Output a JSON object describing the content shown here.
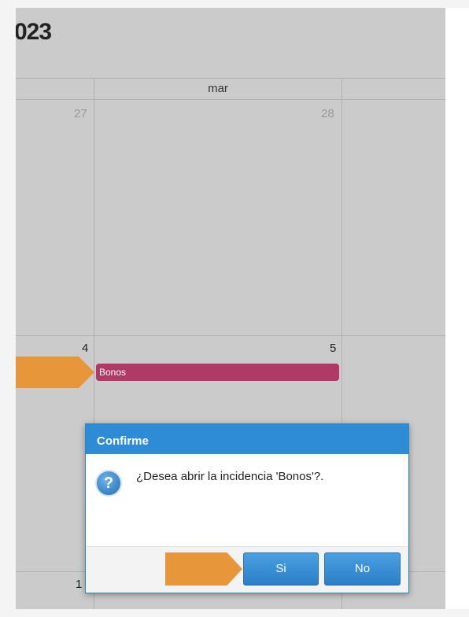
{
  "header": {
    "title_fragment": "023"
  },
  "calendar": {
    "day_header": "mar",
    "row1": {
      "left_number": "27",
      "right_number": "28"
    },
    "row2": {
      "left_number": "4",
      "right_number": "5"
    },
    "row3": {
      "left_number": "1"
    },
    "event": {
      "label": "Bonos",
      "color": "#b03a65"
    }
  },
  "dialog": {
    "title": "Confirme",
    "message": "¿Desea abrir la incidencia 'Bonos'?.",
    "icon": "question-icon",
    "icon_glyph": "?",
    "buttons": {
      "yes": "Si",
      "no": "No"
    }
  },
  "colors": {
    "accent": "#2e8cd6",
    "pointer": "#e8963a"
  }
}
